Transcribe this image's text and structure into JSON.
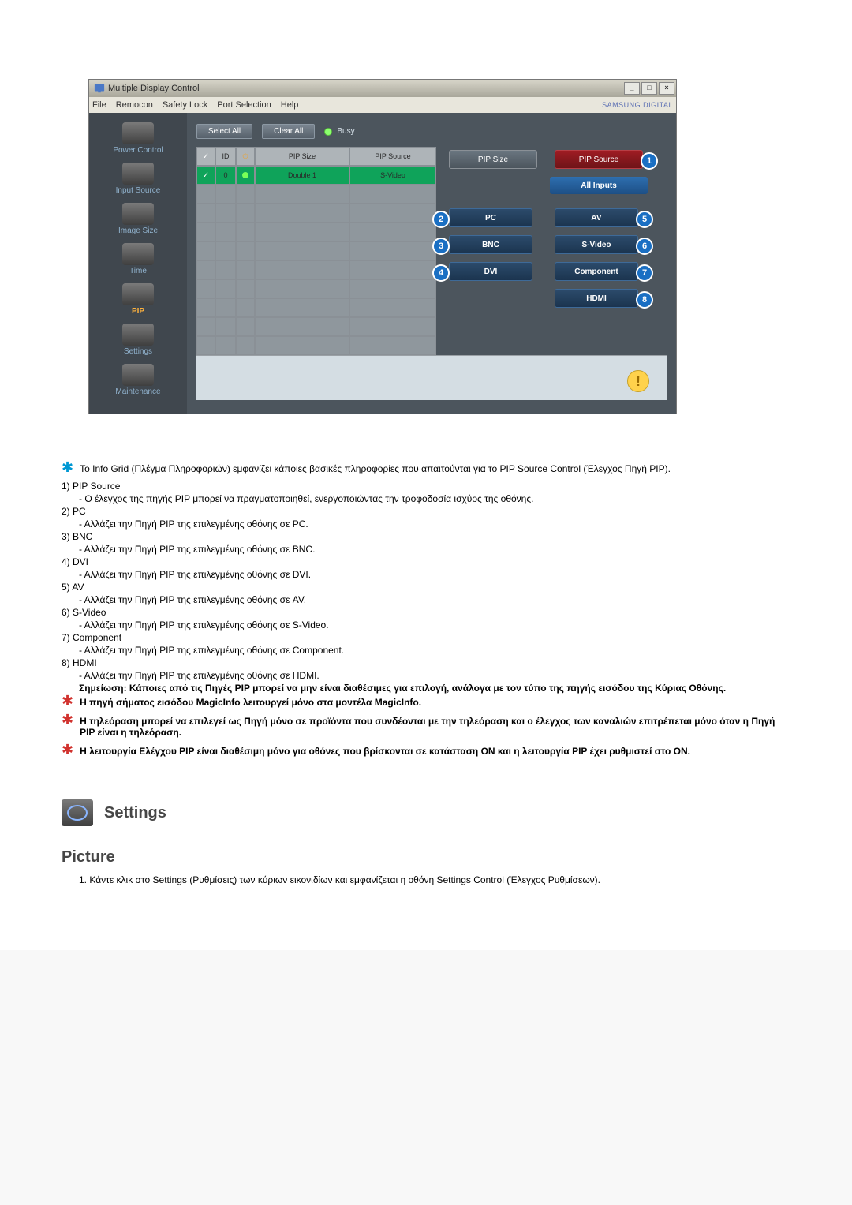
{
  "window": {
    "title": "Multiple Display Control",
    "brand": "SAMSUNG DIGITAL",
    "min": "_",
    "max": "□",
    "close": "×"
  },
  "menu": {
    "file": "File",
    "remocon": "Remocon",
    "safety": "Safety Lock",
    "port": "Port Selection",
    "help": "Help"
  },
  "sidebar": {
    "power": "Power Control",
    "input": "Input Source",
    "image": "Image Size",
    "time": "Time",
    "pip": "PIP",
    "settings": "Settings",
    "maintenance": "Maintenance"
  },
  "toolbar": {
    "select_all": "Select All",
    "clear_all": "Clear All",
    "busy": "Busy"
  },
  "grid": {
    "head_check": "✓",
    "head_id": "ID",
    "head_power_icon": "⏻",
    "head_pip_size": "PIP Size",
    "head_pip_source": "PIP Source",
    "row0_id": "0",
    "row0_pip_size": "Double 1",
    "row0_pip_source": "S-Video"
  },
  "panel": {
    "pip_size": "PIP Size",
    "pip_source": "PIP Source",
    "all_inputs": "All Inputs",
    "pc": "PC",
    "bnc": "BNC",
    "dvi": "DVI",
    "av": "AV",
    "svideo": "S-Video",
    "component": "Component",
    "hdmi": "HDMI",
    "n1": "1",
    "n2": "2",
    "n3": "3",
    "n4": "4",
    "n5": "5",
    "n6": "6",
    "n7": "7",
    "n8": "8",
    "alert": "!"
  },
  "doc": {
    "intro": "Το Info Grid (Πλέγμα Πληροφοριών) εμφανίζει κάποιες βασικές πληροφορίες που απαιτούνται για το PIP Source Control (Έλεγχος Πηγή PIP).",
    "t1": "1)  PIP Source",
    "d1": "- Ο έλεγχος της πηγής PIP μπορεί να πραγματοποιηθεί, ενεργοποιώντας την τροφοδοσία ισχύος της οθόνης.",
    "t2": "2)  PC",
    "d2": "- Αλλάζει την Πηγή PIP της επιλεγμένης οθόνης σε PC.",
    "t3": "3)  BNC",
    "d3": "- Αλλάζει την Πηγή PIP της επιλεγμένης οθόνης σε BNC.",
    "t4": "4)  DVI",
    "d4": "- Αλλάζει την Πηγή PIP της επιλεγμένης οθόνης σε DVI.",
    "t5": "5)  AV",
    "d5": "- Αλλάζει την Πηγή PIP της επιλεγμένης οθόνης σε AV.",
    "t6": "6)  S-Video",
    "d6": "- Αλλάζει την Πηγή PIP της επιλεγμένης οθόνης σε S-Video.",
    "t7": "7)  Component",
    "d7": "- Αλλάζει την Πηγή PIP της επιλεγμένης οθόνης σε Component.",
    "t8": "8)  HDMI",
    "d8": "- Αλλάζει την Πηγή PIP της επιλεγμένης οθόνης σε HDMI.",
    "note": "Σημείωση: Κάποιες από τις Πηγές PIP μπορεί να μην είναι διαθέσιμες για επιλογή, ανάλογα με τον τύπο της πηγής εισόδου της Κύριας Οθόνης.",
    "star1": "Η πηγή σήματος εισόδου MagicInfo λειτουργεί μόνο στα μοντέλα MagicInfo.",
    "star2": "Η τηλεόραση μπορεί να επιλεγεί ως Πηγή μόνο σε προϊόντα που συνδέονται με την τηλεόραση και ο έλεγχος των καναλιών επιτρέπεται μόνο όταν η Πηγή PIP είναι η τηλεόραση.",
    "star3": "Η λειτουργία Ελέγχου PIP είναι διαθέσιμη μόνο για οθόνες που βρίσκονται σε κατάσταση ON και η λειτουργία PIP έχει ρυθμιστεί στο ON.",
    "settings_heading": "Settings",
    "picture_heading": "Picture",
    "picture_step1": "1.  Κάντε κλικ στο Settings (Ρυθμίσεις) των κύριων εικονιδίων και εμφανίζεται η οθόνη Settings Control (Έλεγχος Ρυθμίσεων)."
  }
}
